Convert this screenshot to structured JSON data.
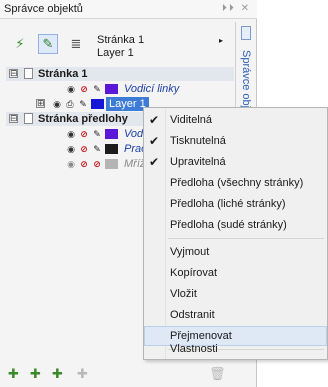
{
  "window": {
    "title": "Správce objektů",
    "controls": "⏵⏵ ✕",
    "side_tab": "Správce obj"
  },
  "toolbar": {
    "page_name": "Stránka 1",
    "layer_name": "Layer 1",
    "arrow": "▸"
  },
  "tree": [
    {
      "kind": "page",
      "expand": "⊟",
      "label": "Stránka 1"
    },
    {
      "kind": "layer",
      "label": "Vodicí linky",
      "italic": true,
      "swatch": "#5b17d8"
    },
    {
      "kind": "layer",
      "expand": "⊞",
      "label": "Layer 1",
      "selected": true,
      "swatch": "#1616d6"
    },
    {
      "kind": "page",
      "expand": "⊟",
      "label": "Stránka předlohy"
    },
    {
      "kind": "layer",
      "label": "Vodi",
      "italic": true,
      "swatch": "#5b17d8"
    },
    {
      "kind": "layer",
      "label": "Prac",
      "italic": true,
      "swatch": "#1c1c1c"
    },
    {
      "kind": "layer",
      "label": "Mřížk",
      "italic": true,
      "swatch": "#b4b4b4"
    }
  ],
  "menu": {
    "items": [
      {
        "label": "Viditelná",
        "checked": true
      },
      {
        "label": "Tisknutelná",
        "checked": true
      },
      {
        "label": "Upravitelná",
        "checked": true
      },
      {
        "label": "Předloha (všechny stránky)",
        "checked": false
      },
      {
        "label": "Předloha (liché stránky)",
        "checked": false
      },
      {
        "label": "Předloha (sudé stránky)",
        "checked": false
      },
      {
        "label": "Vyjmout",
        "checked": false
      },
      {
        "label": "Kopírovat",
        "checked": false
      },
      {
        "label": "Vložit",
        "checked": false
      },
      {
        "label": "Odstranit",
        "checked": false
      },
      {
        "label": "Přejmenovat",
        "checked": false,
        "hover": true
      },
      {
        "label": "Vlastnosti",
        "checked": false
      }
    ],
    "check_glyph": "✔"
  },
  "colors": {
    "selection": "#3c7bd6",
    "page_row": "#e2e7ee",
    "menu_bg": "#f0f0f0"
  }
}
